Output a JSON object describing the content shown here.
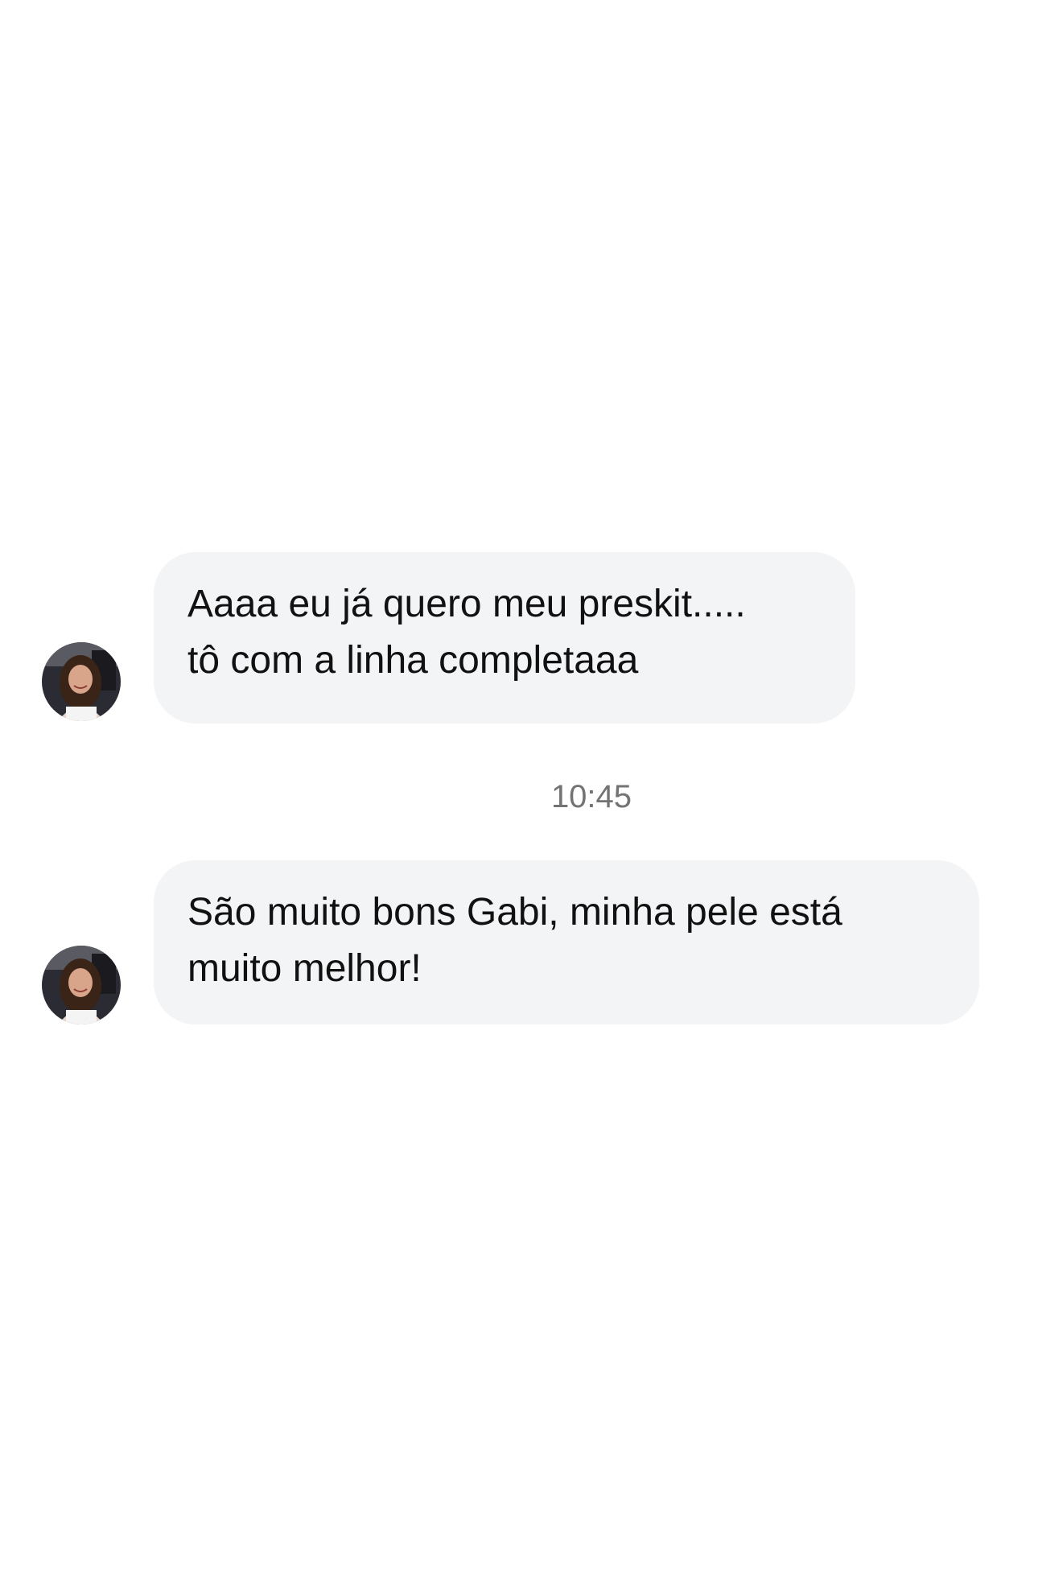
{
  "conversation": {
    "messages": [
      {
        "sender_avatar": "profile-photo-avatar",
        "lines": [
          "Aaaa eu já quero meu preskit.....",
          "tô com a linha completaaa"
        ]
      },
      {
        "sender_avatar": "profile-photo-avatar",
        "lines": [
          "São muito bons Gabi, minha pele está",
          "muito melhor!"
        ]
      }
    ],
    "timestamp": "10:45"
  },
  "colors": {
    "background": "#ffffff",
    "bubble": "#f3f4f6",
    "text": "#111111",
    "timestamp": "#737373"
  }
}
